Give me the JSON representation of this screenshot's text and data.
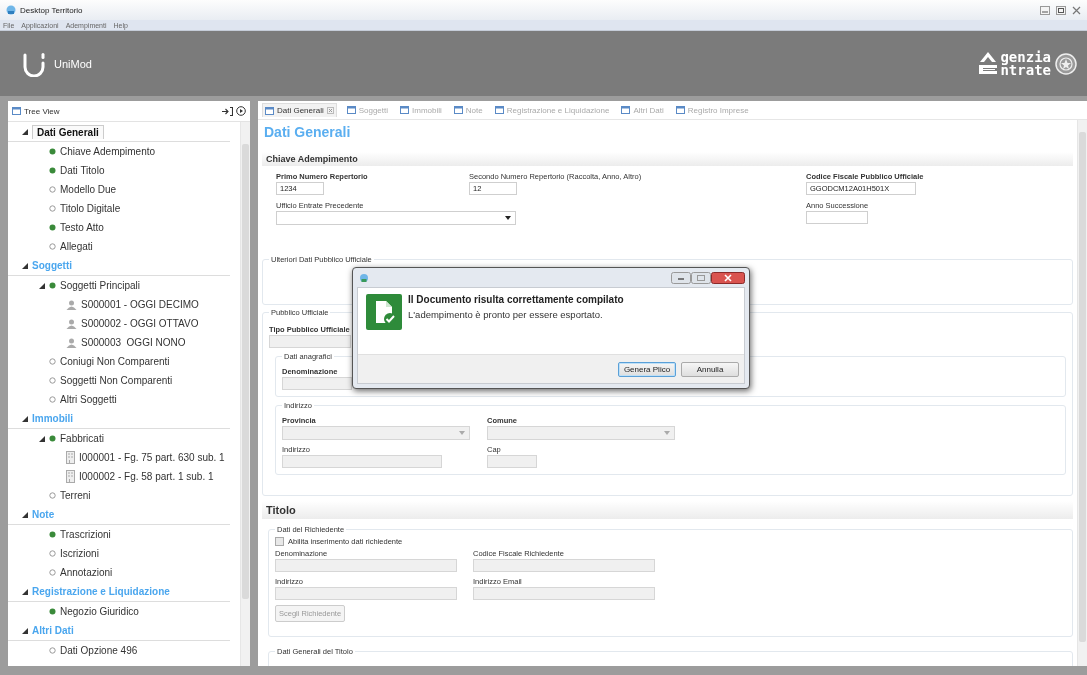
{
  "window": {
    "title": "Desktop Territorio"
  },
  "menu": [
    "File",
    "Applicazioni",
    "Adempimenti",
    "Help"
  ],
  "header": {
    "app_name": "UniMod",
    "agency_logo": [
      "genzia",
      "ntrate"
    ]
  },
  "tree_panel": {
    "title": "Tree View",
    "sections": [
      {
        "kind": "section",
        "label": "Dati Generali",
        "selected": true,
        "expanded": true,
        "children": [
          {
            "kind": "item",
            "label": "Chiave Adempimento",
            "complete": true
          },
          {
            "kind": "item",
            "label": "Dati Titolo",
            "complete": true
          },
          {
            "kind": "item",
            "label": "Modello Due",
            "complete": false
          },
          {
            "kind": "item",
            "label": "Titolo Digitale",
            "complete": false
          },
          {
            "kind": "item",
            "label": "Testo Atto",
            "complete": true
          },
          {
            "kind": "item",
            "label": "Allegati",
            "complete": false
          }
        ]
      },
      {
        "kind": "section",
        "label": "Soggetti",
        "selected": false,
        "expanded": true,
        "children": [
          {
            "kind": "item",
            "label": "Soggetti Principali",
            "complete": true,
            "expanded": true,
            "children": [
              {
                "kind": "subject",
                "label": "S000001 - OGGI DECIMO"
              },
              {
                "kind": "subject",
                "label": "S000002 - OGGI OTTAVO"
              },
              {
                "kind": "subject",
                "label": "S000003  OGGI NONO"
              }
            ]
          },
          {
            "kind": "item",
            "label": "Coniugi Non Comparenti",
            "complete": false
          },
          {
            "kind": "item",
            "label": "Soggetti Non Comparenti",
            "complete": false
          },
          {
            "kind": "item",
            "label": "Altri Soggetti",
            "complete": false
          }
        ]
      },
      {
        "kind": "section",
        "label": "Immobili",
        "selected": false,
        "expanded": true,
        "children": [
          {
            "kind": "item",
            "label": "Fabbricati",
            "complete": true,
            "expanded": true,
            "children": [
              {
                "kind": "property",
                "label": "I000001 - Fg. 75 part. 630 sub. 1"
              },
              {
                "kind": "property",
                "label": "I000002 - Fg. 58 part. 1 sub. 1"
              }
            ]
          },
          {
            "kind": "item",
            "label": "Terreni",
            "complete": false
          }
        ]
      },
      {
        "kind": "section",
        "label": "Note",
        "selected": false,
        "expanded": true,
        "children": [
          {
            "kind": "item",
            "label": "Trascrizioni",
            "complete": true
          },
          {
            "kind": "item",
            "label": "Iscrizioni",
            "complete": false
          },
          {
            "kind": "item",
            "label": "Annotazioni",
            "complete": false
          }
        ]
      },
      {
        "kind": "section",
        "label": "Registrazione e Liquidazione",
        "selected": false,
        "expanded": true,
        "children": [
          {
            "kind": "item",
            "label": "Negozio Giuridico",
            "complete": true
          }
        ]
      },
      {
        "kind": "section",
        "label": "Altri Dati",
        "selected": false,
        "expanded": true,
        "children": [
          {
            "kind": "item",
            "label": "Dati Opzione 496",
            "complete": false
          }
        ]
      }
    ]
  },
  "editor": {
    "tabs": [
      {
        "label": "Dati Generali",
        "selected": true
      },
      {
        "label": "Soggetti",
        "selected": false
      },
      {
        "label": "Immobili",
        "selected": false
      },
      {
        "label": "Note",
        "selected": false
      },
      {
        "label": "Registrazione e Liquidazione",
        "selected": false
      },
      {
        "label": "Altri Dati",
        "selected": false
      },
      {
        "label": "Registro Imprese",
        "selected": false
      }
    ],
    "heading": "Dati Generali",
    "chiave_adempimento": {
      "title": "Chiave Adempimento",
      "fields": [
        {
          "kind": "input",
          "label": "Primo Numero Repertorio",
          "required": true,
          "value": "1234",
          "disabled": false
        },
        {
          "kind": "input",
          "label": "Secondo Numero Repertorio (Raccolta, Anno, Altro)",
          "required": false,
          "value": "12",
          "disabled": false
        },
        {
          "kind": "input",
          "label": "Codice Fiscale Pubblico Ufficiale",
          "required": true,
          "value": "GGODCM12A01H501X",
          "disabled": false
        },
        {
          "kind": "dropdown",
          "label": "Ufficio Entrate Precedente",
          "required": false,
          "disabled": false
        },
        {
          "kind": "input",
          "label": "Anno Successione",
          "required": false,
          "disabled": false
        }
      ]
    },
    "ulteriori_dati": {
      "legend": "Ulteriori Dati Pubblico Ufficiale"
    },
    "pubblico_ufficiale": {
      "legend": "Pubblico Ufficiale",
      "tipo": {
        "kind": "input",
        "label": "Tipo Pubblico Ufficiale",
        "required": true,
        "disabled": true
      },
      "dati_anagrafici": {
        "legend": "Dati anagrafici",
        "fields": [
          {
            "kind": "input",
            "label": "Denominazione",
            "required": true,
            "disabled": true
          }
        ]
      },
      "indirizzo": {
        "legend": "Indirizzo",
        "fields": [
          {
            "kind": "dropdown",
            "label": "Provincia",
            "required": true,
            "disabled": true
          },
          {
            "kind": "dropdown",
            "label": "Comune",
            "required": true,
            "disabled": true
          },
          {
            "kind": "input",
            "label": "Indirizzo",
            "required": false,
            "disabled": true
          },
          {
            "kind": "input",
            "label": "Cap",
            "required": false,
            "disabled": true
          }
        ]
      }
    },
    "titolo": {
      "title": "Titolo",
      "dati_richiedente": {
        "legend": "Dati del Richiedente",
        "checkbox": {
          "label": "Abilita inserimento dati richiedente",
          "checked": false
        },
        "fields": [
          {
            "kind": "input",
            "label": "Denominazione",
            "required": false,
            "disabled": true
          },
          {
            "kind": "input",
            "label": "Codice Fiscale Richiedente",
            "required": false,
            "disabled": true
          },
          {
            "kind": "input",
            "label": "Indirizzo",
            "required": false,
            "disabled": true
          },
          {
            "kind": "input",
            "label": "Indirizzo Email",
            "required": false,
            "disabled": true
          }
        ],
        "button": {
          "label": "Scegli Richiedente",
          "disabled": true
        }
      },
      "dati_generali_titolo": {
        "legend": "Dati Generali del Titolo"
      }
    }
  },
  "dialog": {
    "heading": "Il Documento risulta correttamente compilato",
    "message": "L'adempimento è pronto per essere esportato.",
    "buttons": [
      {
        "label": "Genera Plico",
        "default": true
      },
      {
        "label": "Annulla",
        "default": false
      }
    ]
  }
}
